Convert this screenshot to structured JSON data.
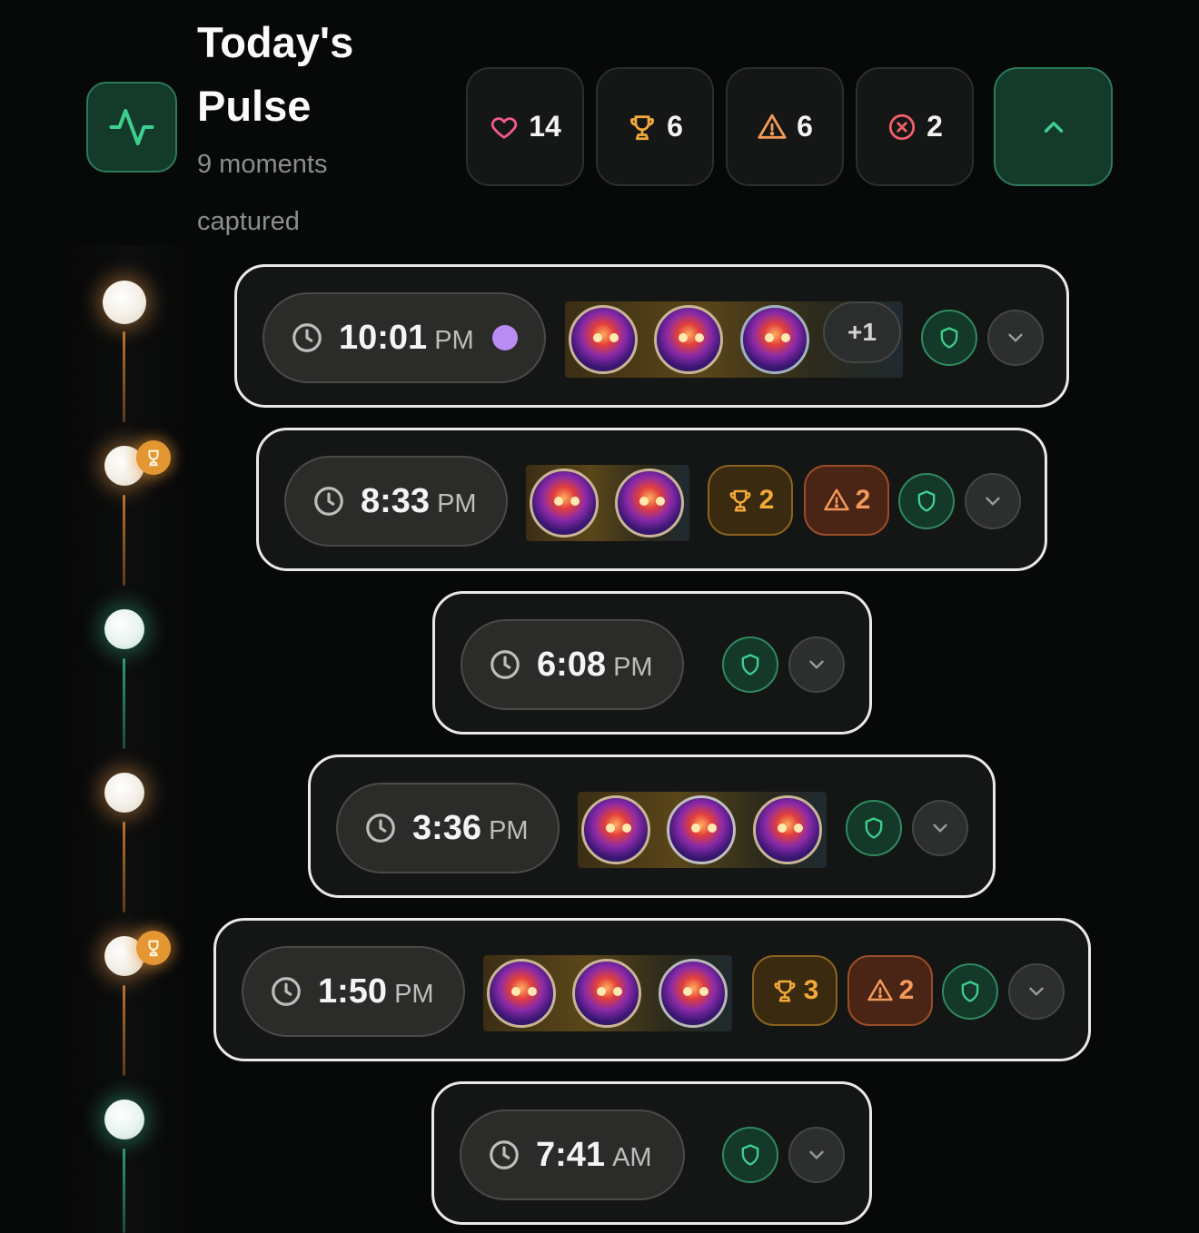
{
  "header": {
    "title": "Today's Pulse",
    "subtitle": "9 moments captured",
    "icon": "activity-icon",
    "accent": "#3ecf8e"
  },
  "stats": [
    {
      "icon": "heart-icon",
      "value": "14",
      "color": "#f05a8c"
    },
    {
      "icon": "trophy-icon",
      "value": "6",
      "color": "#f2a93a"
    },
    {
      "icon": "warning-icon",
      "value": "6",
      "color": "#f39a5a"
    },
    {
      "icon": "x-circle-icon",
      "value": "2",
      "color": "#f0606a"
    }
  ],
  "collapse_icon": "chevron-up-icon",
  "moments": [
    {
      "time": "10:01",
      "ampm": "PM",
      "live": true,
      "avatars": 3,
      "extra": "+1",
      "trophies": null,
      "warnings": null
    },
    {
      "time": "8:33",
      "ampm": "PM",
      "live": false,
      "avatars": 2,
      "extra": null,
      "trophies": "2",
      "warnings": "2"
    },
    {
      "time": "6:08",
      "ampm": "PM",
      "live": false,
      "avatars": 0,
      "extra": null,
      "trophies": null,
      "warnings": null
    },
    {
      "time": "3:36",
      "ampm": "PM",
      "live": false,
      "avatars": 3,
      "extra": null,
      "trophies": null,
      "warnings": null
    },
    {
      "time": "1:50",
      "ampm": "PM",
      "live": false,
      "avatars": 3,
      "extra": null,
      "trophies": "3",
      "warnings": "2"
    },
    {
      "time": "7:41",
      "ampm": "AM",
      "live": false,
      "avatars": 0,
      "extra": null,
      "trophies": null,
      "warnings": null
    }
  ],
  "colors": {
    "trophy": "#f2a93a",
    "warning": "#f39a5a",
    "shield": "#3ecf8e",
    "live_dot": "#b88cf2"
  }
}
